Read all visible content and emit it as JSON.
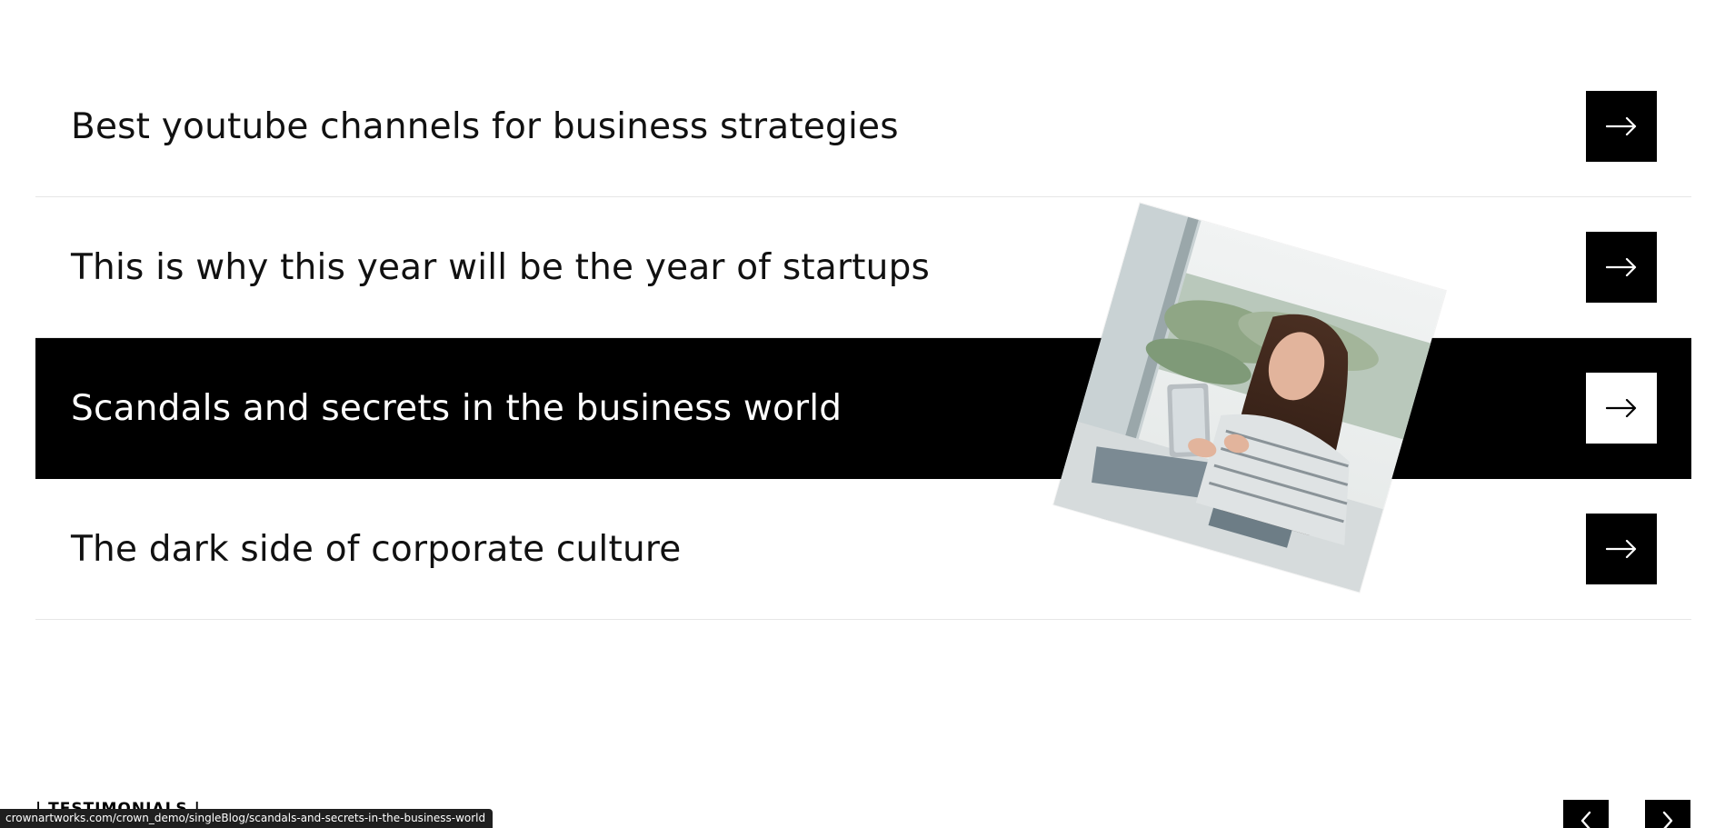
{
  "blog_list": {
    "items": [
      {
        "title": "Best youtube channels for business strategies"
      },
      {
        "title": "This is why this year will be the year of startups"
      },
      {
        "title": "Scandals and secrets in the business world"
      },
      {
        "title": "The dark side of corporate culture"
      }
    ]
  },
  "hover_image": {
    "subject": "woman-using-tablet-photo"
  },
  "testimonials": {
    "label": "| TESTIMONIALS |"
  },
  "status_bar": {
    "url": "crownartworks.com/crown_demo/singleBlog/scandals-and-secrets-in-the-business-world"
  },
  "colors": {
    "accent": "#000000",
    "background": "#ffffff",
    "divider": "#e6e6e6"
  }
}
